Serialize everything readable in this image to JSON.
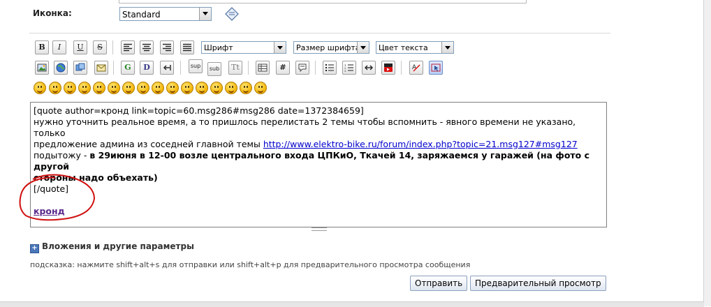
{
  "icon_field": {
    "label": "Иконка:",
    "selected": "Standard"
  },
  "toolbar": {
    "bold": "B",
    "italic": "I",
    "underline": "U",
    "strike": "S",
    "font_select": "Шрифт",
    "size_select": "Размер шрифта",
    "color_select": "Цвет текста",
    "glow": "G",
    "shadow": "D",
    "sup": "sup",
    "sub": "sub",
    "teletype": "Tt",
    "hash": "#"
  },
  "editor": {
    "line1": "[quote author=кронд link=topic=60.msg286#msg286 date=1372384659]",
    "line2": "нужно уточнить реальное время, а то пришлось перелистать 2 темы чтобы вспомнить - явного времени не указано, только",
    "line3_text": "предложение админа из соседней главной темы ",
    "line3_link": "http://www.elektro-bike.ru/forum/index.php?topic=21.msg127#msg127",
    "line4_prefix": "подытожу - ",
    "line4_bold": "в 29июня в 12-00 возле центрального входа ЦПКиО, Ткачей 14, заряжаемся у гаражей (на фото с другой",
    "line5_bold": "стороны надо объехать)",
    "line6": "[/quote]",
    "username": "кронд"
  },
  "attachments_label": "Вложения и другие параметры",
  "hint": "подсказка: нажмите shift+alt+s для отправки или shift+alt+p для предварительного просмотра сообщения",
  "buttons": {
    "send": "Отправить",
    "preview": "Предварительный просмотр"
  },
  "colors": {
    "link": "#0000cc",
    "annotation_circle": "#d01010",
    "username": "#5c2a8c"
  }
}
